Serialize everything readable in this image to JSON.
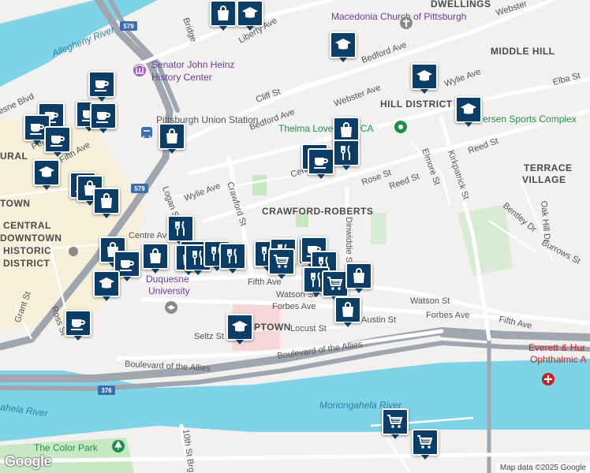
{
  "map": {
    "neighborhoods": [
      "DWELLINGS",
      "MIDDLE HILL",
      "HILL DISTRICT",
      "TERRACE",
      "VILLAGE",
      "CRAWFORD-ROBERTS",
      "CENTRAL",
      "DOWNTOWN",
      "HISTORIC",
      "DISTRICT",
      "TOWN",
      "PTOWN",
      "URAL"
    ],
    "streets": [
      "Liberty Ave",
      "Webster",
      "Bedford Ave",
      "Wylie Ave",
      "Webster Ave",
      "Cliff St",
      "Bedford Ave",
      "Elba St",
      "Reed St",
      "Centre Ave",
      "Rose St",
      "Reed St",
      "Elmore St",
      "Kirkpatrick St",
      "Wylie Ave",
      "Crawford St",
      "Logan St",
      "Oak Hill Dr",
      "Bentley Dr",
      "Burrows St",
      "Fifth Ave",
      "Fifth Ave",
      "Watson St",
      "Watson St",
      "Forbes Ave",
      "Forbes Ave",
      "Locust St",
      "Austin St",
      "Seltz St",
      "Ross St",
      "Grant St",
      "Boulevard of the Allies",
      "Boulevard of the Allies",
      "10th St Brg",
      "Dinwiddie St",
      "Centre Av",
      "esne Blvd",
      "Penn Ave",
      "Bridge",
      "Fifth Ave",
      "Pe"
    ],
    "pois": [
      {
        "name": "Macedonia Church of Pittsburgh",
        "style": "poi"
      },
      {
        "name": "Senator John Heinz",
        "style": "poi"
      },
      {
        "name": "History Center",
        "style": "poi"
      },
      {
        "name": "Pittsburgh Union Station",
        "style": "street"
      },
      {
        "name": "Thelma Lovette YMCA",
        "style": "poi-green"
      },
      {
        "name": "ersen Sports Complex",
        "style": "poi-green"
      },
      {
        "name": "Duquesne",
        "style": "poi"
      },
      {
        "name": "University",
        "style": "poi"
      },
      {
        "name": "Everett & Hur",
        "style": "poi-red"
      },
      {
        "name": "Ophthalmic A",
        "style": "poi-red"
      },
      {
        "name": "The Color Park",
        "style": "poi-green"
      }
    ],
    "water": [
      "Allegheny River",
      "Monongahela River",
      "ahela River"
    ],
    "highways": [
      "579",
      "579",
      "376"
    ],
    "attribution": "Map data ©2025 Google",
    "logo": "Google",
    "colors": {
      "water": "#7fd3e6",
      "marker": "#0b3d67",
      "park": "#c8e8c3",
      "campus": "#f6d7d7",
      "highway": "#9fa6b0"
    }
  },
  "markers": [
    {
      "type": "cafe",
      "label": "cafe-icon"
    },
    {
      "type": "shopping",
      "label": "shopping-bag-icon"
    },
    {
      "type": "school",
      "label": "school-icon"
    },
    {
      "type": "restaurant",
      "label": "restaurant-icon"
    },
    {
      "type": "grocery",
      "label": "shopping-cart-icon"
    }
  ]
}
